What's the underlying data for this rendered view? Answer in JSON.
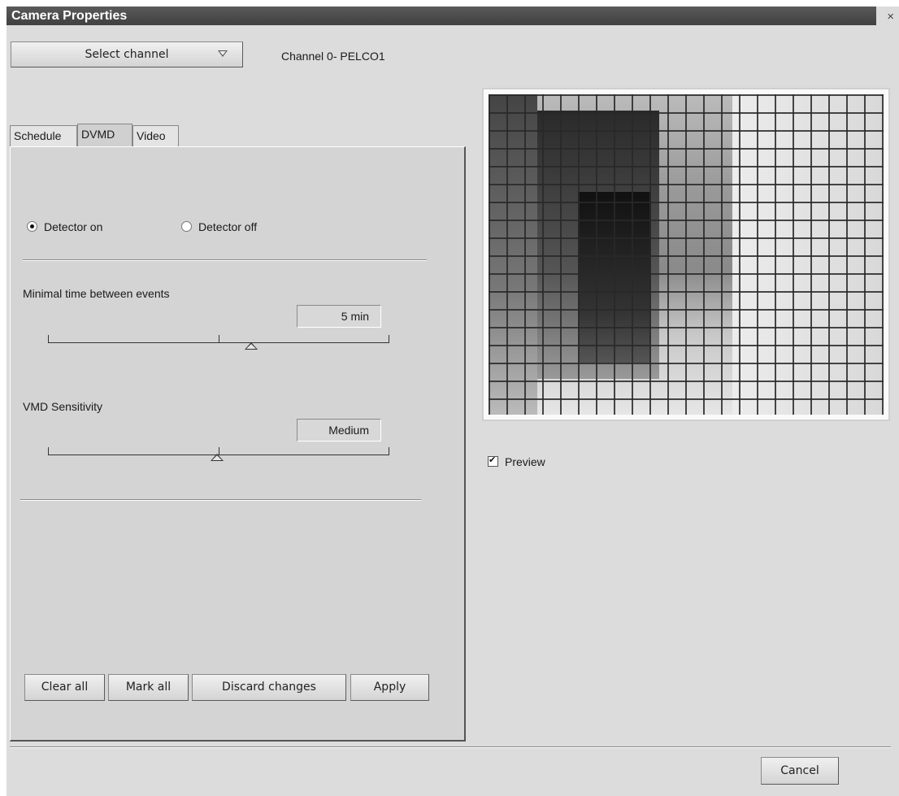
{
  "window": {
    "title": "Camera Properties",
    "close_glyph": "×"
  },
  "channel": {
    "select_label": "Select channel",
    "current": "Channel 0- PELCO1"
  },
  "tabs": [
    {
      "label": "Schedule",
      "active": false
    },
    {
      "label": "DVMD",
      "active": true
    },
    {
      "label": "Video",
      "active": false
    }
  ],
  "dvmd": {
    "detector_on_label": "Detector on",
    "detector_off_label": "Detector off",
    "detector_state": "on",
    "min_time_label": "Minimal time between events",
    "min_time_value": "5 min",
    "sensitivity_label": "VMD Sensitivity",
    "sensitivity_value": "Medium"
  },
  "buttons": {
    "clear_all": "Clear all",
    "mark_all": "Mark all",
    "discard_changes": "Discard changes",
    "apply": "Apply",
    "cancel": "Cancel"
  },
  "preview": {
    "label": "Preview",
    "checked": true
  }
}
